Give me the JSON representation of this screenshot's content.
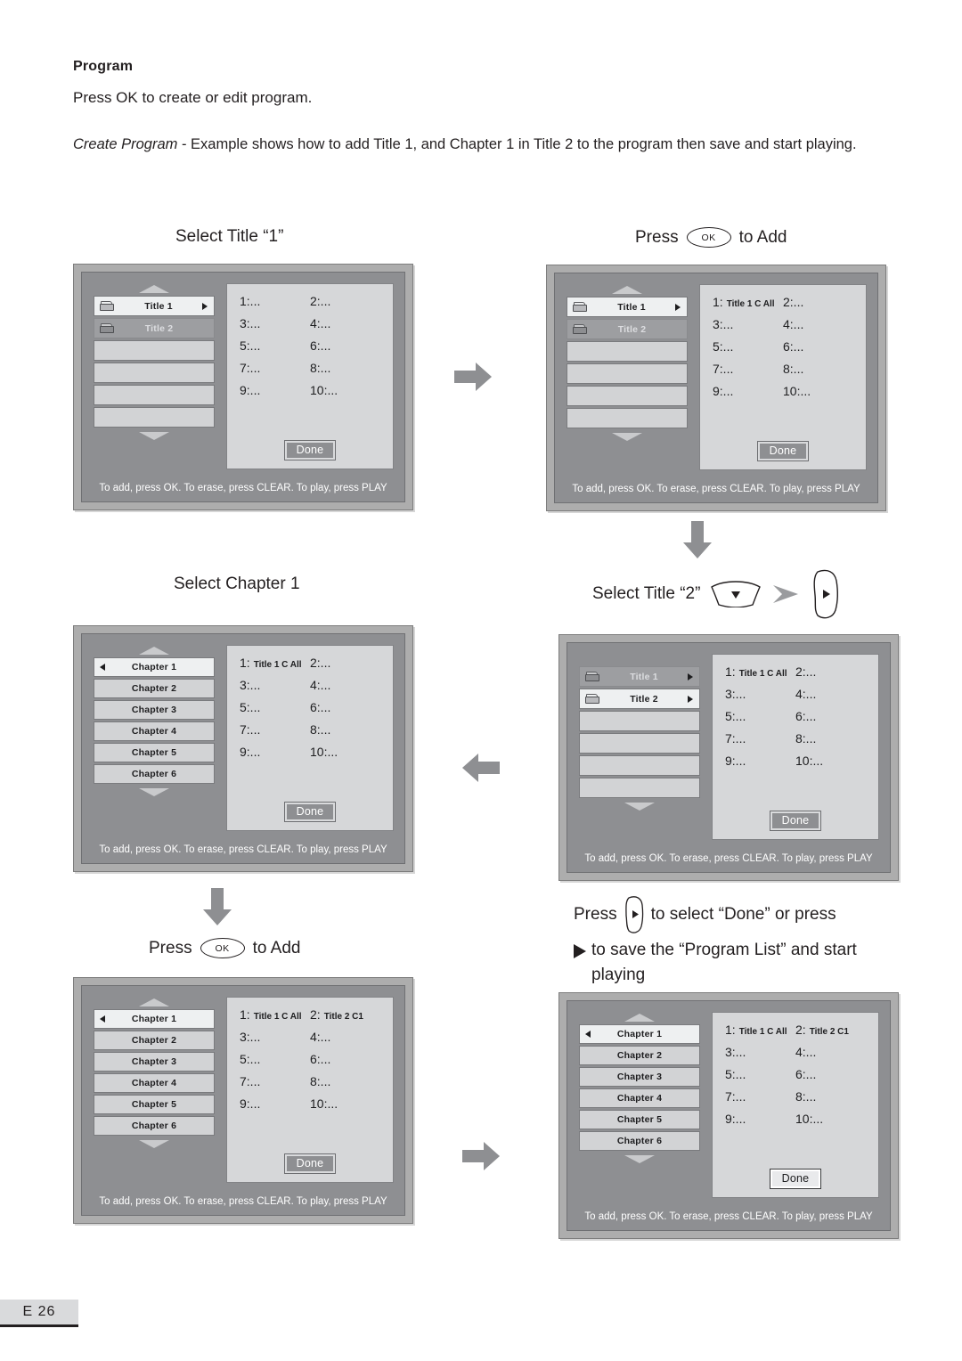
{
  "intro": {
    "heading": "Program",
    "line1": "Press OK to create or edit program.",
    "para2_italic": "Create Program",
    "para2_rest": " - Example shows how to add Title 1, and Chapter 1 in Title 2 to the program  then save and start playing."
  },
  "status_text": "To add, press OK. To erase, press CLEAR. To play, press PLAY",
  "done_label": "Done",
  "ok_key_label": "OK",
  "steps": [
    {
      "id": "step1",
      "caption": "Select Title “1”",
      "caption_key": null,
      "caption_suffix": null,
      "list": [
        {
          "label": "Title 1",
          "icon": "folder-icon",
          "state": "selected",
          "caret": "right"
        },
        {
          "label": "Title 2",
          "icon": "folder-icon",
          "state": "dim",
          "caret": "none"
        },
        {
          "label": "",
          "icon": "none",
          "state": "empty",
          "caret": "none"
        },
        {
          "label": "",
          "icon": "none",
          "state": "empty",
          "caret": "none"
        },
        {
          "label": "",
          "icon": "none",
          "state": "empty",
          "caret": "none"
        },
        {
          "label": "",
          "icon": "none",
          "state": "empty",
          "caret": "none"
        }
      ],
      "program": [
        {
          "num": "1:...",
          "value": ""
        },
        {
          "num": "2:...",
          "value": ""
        },
        {
          "num": "3:...",
          "value": ""
        },
        {
          "num": "4:...",
          "value": ""
        },
        {
          "num": "5:...",
          "value": ""
        },
        {
          "num": "6:...",
          "value": ""
        },
        {
          "num": "7:...",
          "value": ""
        },
        {
          "num": "8:...",
          "value": ""
        },
        {
          "num": "9:...",
          "value": ""
        },
        {
          "num": "10:...",
          "value": ""
        }
      ],
      "done_highlight": false
    },
    {
      "id": "step2",
      "caption": "Press",
      "caption_key": "ok-key",
      "caption_suffix": "to Add",
      "list": [
        {
          "label": "Title 1",
          "icon": "folder-icon",
          "state": "selected",
          "caret": "right"
        },
        {
          "label": "Title 2",
          "icon": "folder-icon",
          "state": "dim",
          "caret": "none"
        },
        {
          "label": "",
          "icon": "none",
          "state": "empty",
          "caret": "none"
        },
        {
          "label": "",
          "icon": "none",
          "state": "empty",
          "caret": "none"
        },
        {
          "label": "",
          "icon": "none",
          "state": "empty",
          "caret": "none"
        },
        {
          "label": "",
          "icon": "none",
          "state": "empty",
          "caret": "none"
        }
      ],
      "program": [
        {
          "num": "1:",
          "value": "Title 1 C All"
        },
        {
          "num": "2:...",
          "value": ""
        },
        {
          "num": "3:...",
          "value": ""
        },
        {
          "num": "4:...",
          "value": ""
        },
        {
          "num": "5:...",
          "value": ""
        },
        {
          "num": "6:...",
          "value": ""
        },
        {
          "num": "7:...",
          "value": ""
        },
        {
          "num": "8:...",
          "value": ""
        },
        {
          "num": "9:...",
          "value": ""
        },
        {
          "num": "10:...",
          "value": ""
        }
      ],
      "done_highlight": false
    },
    {
      "id": "step3",
      "caption": "Select Title “2”",
      "caption_key": "down-key-then-right-key",
      "caption_suffix": null,
      "list": [
        {
          "label": "Title 1",
          "icon": "folder-icon",
          "state": "dim",
          "caret": "right"
        },
        {
          "label": "Title 2",
          "icon": "folder-icon",
          "state": "selected",
          "caret": "right"
        },
        {
          "label": "",
          "icon": "none",
          "state": "empty",
          "caret": "none"
        },
        {
          "label": "",
          "icon": "none",
          "state": "empty",
          "caret": "none"
        },
        {
          "label": "",
          "icon": "none",
          "state": "empty",
          "caret": "none"
        },
        {
          "label": "",
          "icon": "none",
          "state": "empty",
          "caret": "none"
        }
      ],
      "program": [
        {
          "num": "1:",
          "value": "Title 1 C All"
        },
        {
          "num": "2:...",
          "value": ""
        },
        {
          "num": "3:...",
          "value": ""
        },
        {
          "num": "4:...",
          "value": ""
        },
        {
          "num": "5:...",
          "value": ""
        },
        {
          "num": "6:...",
          "value": ""
        },
        {
          "num": "7:...",
          "value": ""
        },
        {
          "num": "8:...",
          "value": ""
        },
        {
          "num": "9:...",
          "value": ""
        },
        {
          "num": "10:...",
          "value": ""
        }
      ],
      "done_highlight": false
    },
    {
      "id": "step4",
      "caption": "Select Chapter 1",
      "caption_key": null,
      "caption_suffix": null,
      "list": [
        {
          "label": "Chapter  1",
          "icon": "none",
          "state": "selected",
          "caret": "left"
        },
        {
          "label": "Chapter  2",
          "icon": "none",
          "state": "normal",
          "caret": "none"
        },
        {
          "label": "Chapter  3",
          "icon": "none",
          "state": "normal",
          "caret": "none"
        },
        {
          "label": "Chapter  4",
          "icon": "none",
          "state": "normal",
          "caret": "none"
        },
        {
          "label": "Chapter  5",
          "icon": "none",
          "state": "normal",
          "caret": "none"
        },
        {
          "label": "Chapter  6",
          "icon": "none",
          "state": "normal",
          "caret": "none"
        }
      ],
      "program": [
        {
          "num": "1:",
          "value": "Title 1 C All"
        },
        {
          "num": "2:...",
          "value": ""
        },
        {
          "num": "3:...",
          "value": ""
        },
        {
          "num": "4:...",
          "value": ""
        },
        {
          "num": "5:...",
          "value": ""
        },
        {
          "num": "6:...",
          "value": ""
        },
        {
          "num": "7:...",
          "value": ""
        },
        {
          "num": "8:...",
          "value": ""
        },
        {
          "num": "9:...",
          "value": ""
        },
        {
          "num": "10:...",
          "value": ""
        }
      ],
      "done_highlight": false
    },
    {
      "id": "step5",
      "caption": "Press",
      "caption_key": "ok-key",
      "caption_suffix": "to Add",
      "list": [
        {
          "label": "Chapter  1",
          "icon": "none",
          "state": "selected",
          "caret": "left"
        },
        {
          "label": "Chapter  2",
          "icon": "none",
          "state": "normal",
          "caret": "none"
        },
        {
          "label": "Chapter  3",
          "icon": "none",
          "state": "normal",
          "caret": "none"
        },
        {
          "label": "Chapter  4",
          "icon": "none",
          "state": "normal",
          "caret": "none"
        },
        {
          "label": "Chapter  5",
          "icon": "none",
          "state": "normal",
          "caret": "none"
        },
        {
          "label": "Chapter  6",
          "icon": "none",
          "state": "normal",
          "caret": "none"
        }
      ],
      "program": [
        {
          "num": "1:",
          "value": "Title 1 C All"
        },
        {
          "num": "2:",
          "value": "Title 2 C1"
        },
        {
          "num": "3:...",
          "value": ""
        },
        {
          "num": "4:...",
          "value": ""
        },
        {
          "num": "5:...",
          "value": ""
        },
        {
          "num": "6:...",
          "value": ""
        },
        {
          "num": "7:...",
          "value": ""
        },
        {
          "num": "8:...",
          "value": ""
        },
        {
          "num": "9:...",
          "value": ""
        },
        {
          "num": "10:...",
          "value": ""
        }
      ],
      "done_highlight": false
    },
    {
      "id": "step6",
      "caption_line1_a": "Press",
      "caption_line1_b": "to select “Done” or press",
      "caption_line2": "to save the “Program List” and start playing",
      "list": [
        {
          "label": "Chapter  1",
          "icon": "none",
          "state": "selected",
          "caret": "left"
        },
        {
          "label": "Chapter  2",
          "icon": "none",
          "state": "normal",
          "caret": "none"
        },
        {
          "label": "Chapter  3",
          "icon": "none",
          "state": "normal",
          "caret": "none"
        },
        {
          "label": "Chapter  4",
          "icon": "none",
          "state": "normal",
          "caret": "none"
        },
        {
          "label": "Chapter  5",
          "icon": "none",
          "state": "normal",
          "caret": "none"
        },
        {
          "label": "Chapter  6",
          "icon": "none",
          "state": "normal",
          "caret": "none"
        }
      ],
      "program": [
        {
          "num": "1:",
          "value": "Title 1 C All"
        },
        {
          "num": "2:",
          "value": "Title 2 C1"
        },
        {
          "num": "3:...",
          "value": ""
        },
        {
          "num": "4:...",
          "value": ""
        },
        {
          "num": "5:...",
          "value": ""
        },
        {
          "num": "6:...",
          "value": ""
        },
        {
          "num": "7:...",
          "value": ""
        },
        {
          "num": "8:...",
          "value": ""
        },
        {
          "num": "9:...",
          "value": ""
        },
        {
          "num": "10:...",
          "value": ""
        }
      ],
      "done_highlight": true
    }
  ],
  "footer": {
    "page": "E 26"
  },
  "colors": {
    "arrow_grey": "#8e8f92",
    "panel_bezel": "#adadad",
    "screen_bg": "#8e8f92",
    "list_row": "#d2d3d5",
    "list_row_selected": "#eef0f1",
    "list_row_dim": "#9d9ea1",
    "program_bg": "#d6d7d9",
    "text_dark": "#231f20"
  }
}
